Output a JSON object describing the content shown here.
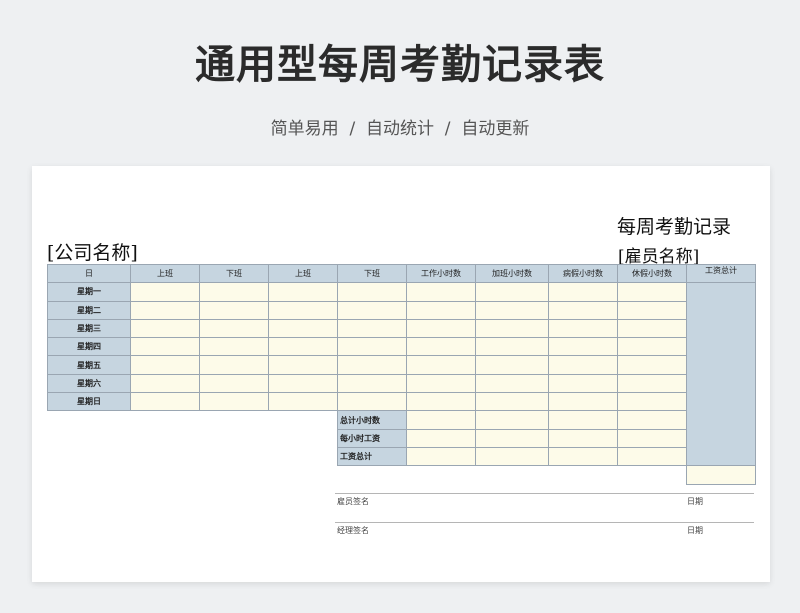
{
  "header": {
    "title": "通用型每周考勤记录表",
    "subtitle": "简单易用  /  自动统计  /  自动更新"
  },
  "sheet": {
    "doc_title": "每周考勤记录",
    "company": "[公司名称]",
    "employee": "[雇员名称]"
  },
  "table": {
    "columns": [
      "日",
      "上班",
      "下班",
      "上班",
      "下班",
      "工作小时数",
      "加班小时数",
      "病假小时数",
      "休假小时数",
      "工资总计"
    ],
    "days": [
      "星期一",
      "星期二",
      "星期三",
      "星期四",
      "星期五",
      "星期六",
      "星期日"
    ],
    "summary": [
      "总计小时数",
      "每小时工资",
      "工资总计"
    ]
  },
  "signatures": {
    "employee_sign": "雇员签名",
    "manager_sign": "经理签名",
    "date": "日期"
  },
  "colors": {
    "header_fill": "#c6d5e0",
    "cell_fill": "#fdfbe9",
    "border": "#9aa6b2"
  }
}
